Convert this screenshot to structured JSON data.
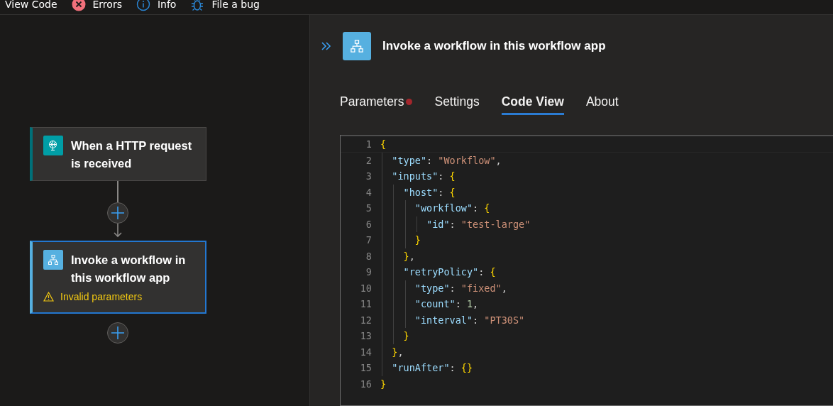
{
  "toolbar": {
    "items": [
      {
        "kind": "text",
        "label": "View Code"
      },
      {
        "kind": "errors",
        "label": "Errors"
      },
      {
        "kind": "info",
        "label": "Info"
      },
      {
        "kind": "bug",
        "label": "File a bug"
      }
    ]
  },
  "canvas": {
    "nodes": [
      {
        "kind": "trigger",
        "title": "When a HTTP request is received",
        "selected": false
      },
      {
        "kind": "action",
        "title": "Invoke a workflow in this workflow app",
        "selected": true,
        "warning": "Invalid parameters"
      }
    ]
  },
  "panel": {
    "title": "Invoke a workflow in this workflow app",
    "tabs": [
      {
        "label": "Parameters",
        "selected": false,
        "error": true
      },
      {
        "label": "Settings",
        "selected": false,
        "error": false
      },
      {
        "label": "Code View",
        "selected": true,
        "error": false
      },
      {
        "label": "About",
        "selected": false,
        "error": false
      }
    ],
    "code": {
      "lines": [
        {
          "number": "1",
          "tokens": [
            {
              "kind": "brace",
              "text": "{"
            }
          ],
          "children": [
            {
              "number": "2",
              "tokens": [
                {
                  "kind": "key",
                  "text": "\"type\""
                },
                {
                  "kind": "punct",
                  "text": ": "
                },
                {
                  "kind": "string",
                  "text": "\"Workflow\""
                },
                {
                  "kind": "punct",
                  "text": ","
                }
              ]
            },
            {
              "number": "3",
              "tokens": [
                {
                  "kind": "key",
                  "text": "\"inputs\""
                },
                {
                  "kind": "punct",
                  "text": ": "
                },
                {
                  "kind": "brace",
                  "text": "{"
                }
              ],
              "children": [
                {
                  "number": "4",
                  "tokens": [
                    {
                      "kind": "key",
                      "text": "\"host\""
                    },
                    {
                      "kind": "punct",
                      "text": ": "
                    },
                    {
                      "kind": "brace",
                      "text": "{"
                    }
                  ],
                  "children": [
                    {
                      "number": "5",
                      "tokens": [
                        {
                          "kind": "key",
                          "text": "\"workflow\""
                        },
                        {
                          "kind": "punct",
                          "text": ": "
                        },
                        {
                          "kind": "brace",
                          "text": "{"
                        }
                      ],
                      "children": [
                        {
                          "number": "6",
                          "tokens": [
                            {
                              "kind": "key",
                              "text": "\"id\""
                            },
                            {
                              "kind": "punct",
                              "text": ": "
                            },
                            {
                              "kind": "string",
                              "text": "\"test-large\""
                            }
                          ]
                        }
                      ]
                    },
                    {
                      "number": "7",
                      "tokens": [
                        {
                          "kind": "brace",
                          "text": "}"
                        }
                      ]
                    }
                  ]
                },
                {
                  "number": "8",
                  "tokens": [
                    {
                      "kind": "brace",
                      "text": "}"
                    },
                    {
                      "kind": "punct",
                      "text": ","
                    }
                  ]
                },
                {
                  "number": "9",
                  "tokens": [
                    {
                      "kind": "key",
                      "text": "\"retryPolicy\""
                    },
                    {
                      "kind": "punct",
                      "text": ": "
                    },
                    {
                      "kind": "brace",
                      "text": "{"
                    }
                  ],
                  "children": [
                    {
                      "number": "10",
                      "tokens": [
                        {
                          "kind": "key",
                          "text": "\"type\""
                        },
                        {
                          "kind": "punct",
                          "text": ": "
                        },
                        {
                          "kind": "string",
                          "text": "\"fixed\""
                        },
                        {
                          "kind": "punct",
                          "text": ","
                        }
                      ]
                    },
                    {
                      "number": "11",
                      "tokens": [
                        {
                          "kind": "key",
                          "text": "\"count\""
                        },
                        {
                          "kind": "punct",
                          "text": ": "
                        },
                        {
                          "kind": "number",
                          "text": "1"
                        },
                        {
                          "kind": "punct",
                          "text": ","
                        }
                      ]
                    },
                    {
                      "number": "12",
                      "tokens": [
                        {
                          "kind": "key",
                          "text": "\"interval\""
                        },
                        {
                          "kind": "punct",
                          "text": ": "
                        },
                        {
                          "kind": "string",
                          "text": "\"PT30S\""
                        }
                      ]
                    }
                  ]
                },
                {
                  "number": "13",
                  "tokens": [
                    {
                      "kind": "brace",
                      "text": "}"
                    }
                  ]
                }
              ]
            },
            {
              "number": "14",
              "tokens": [
                {
                  "kind": "brace",
                  "text": "}"
                },
                {
                  "kind": "punct",
                  "text": ","
                }
              ]
            },
            {
              "number": "15",
              "tokens": [
                {
                  "kind": "key",
                  "text": "\"runAfter\""
                },
                {
                  "kind": "punct",
                  "text": ": "
                },
                {
                  "kind": "brace",
                  "text": "{}"
                }
              ]
            }
          ]
        },
        {
          "number": "16",
          "tokens": [
            {
              "kind": "brace",
              "text": "}"
            }
          ]
        }
      ]
    }
  }
}
